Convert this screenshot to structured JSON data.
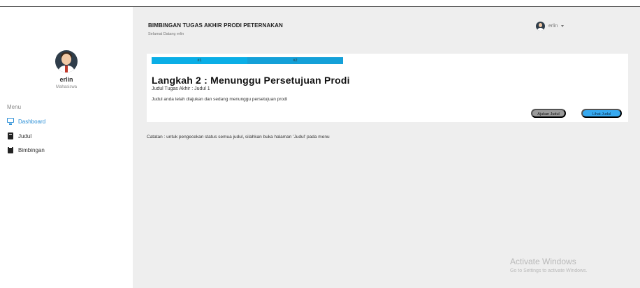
{
  "sidebar": {
    "user_name": "erlin",
    "user_role": "Mahasiswa",
    "menu_label": "Menu",
    "items": [
      {
        "label": "Dashboard",
        "icon": "monitor-icon",
        "active": true
      },
      {
        "label": "Judul",
        "icon": "book-icon",
        "active": false
      },
      {
        "label": "Bimbingan",
        "icon": "clipboard-icon",
        "active": false
      }
    ]
  },
  "header": {
    "title": "BIMBINGAN TUGAS AKHIR PRODI PETERNAKAN",
    "welcome": "Selamat Datang erlin",
    "user_menu_name": "erlin"
  },
  "card": {
    "steps": [
      "#1",
      "#2"
    ],
    "step_title": "Langkah 2 : Menunggu Persetujuan Prodi",
    "judul_info": "Judul Tugas Akhir : Judul 1",
    "status_message": "Judul anda telah diajukan dan sedang menunggu persetujuan prodi",
    "btn_ajukan": "Ajukan Judul",
    "btn_lihat": "Lihat Judul"
  },
  "note": "Catatan : untuk pengecekan status semua judul, silahkan buka halaman 'Judul' pada menu",
  "watermark": {
    "title": "Activate Windows",
    "subtitle": "Go to Settings to activate Windows."
  },
  "colors": {
    "accent": "#36a9f0",
    "step_bar": "#0aaee6",
    "main_bg": "#eeeeee",
    "button_gray": "#9a9a9a"
  }
}
